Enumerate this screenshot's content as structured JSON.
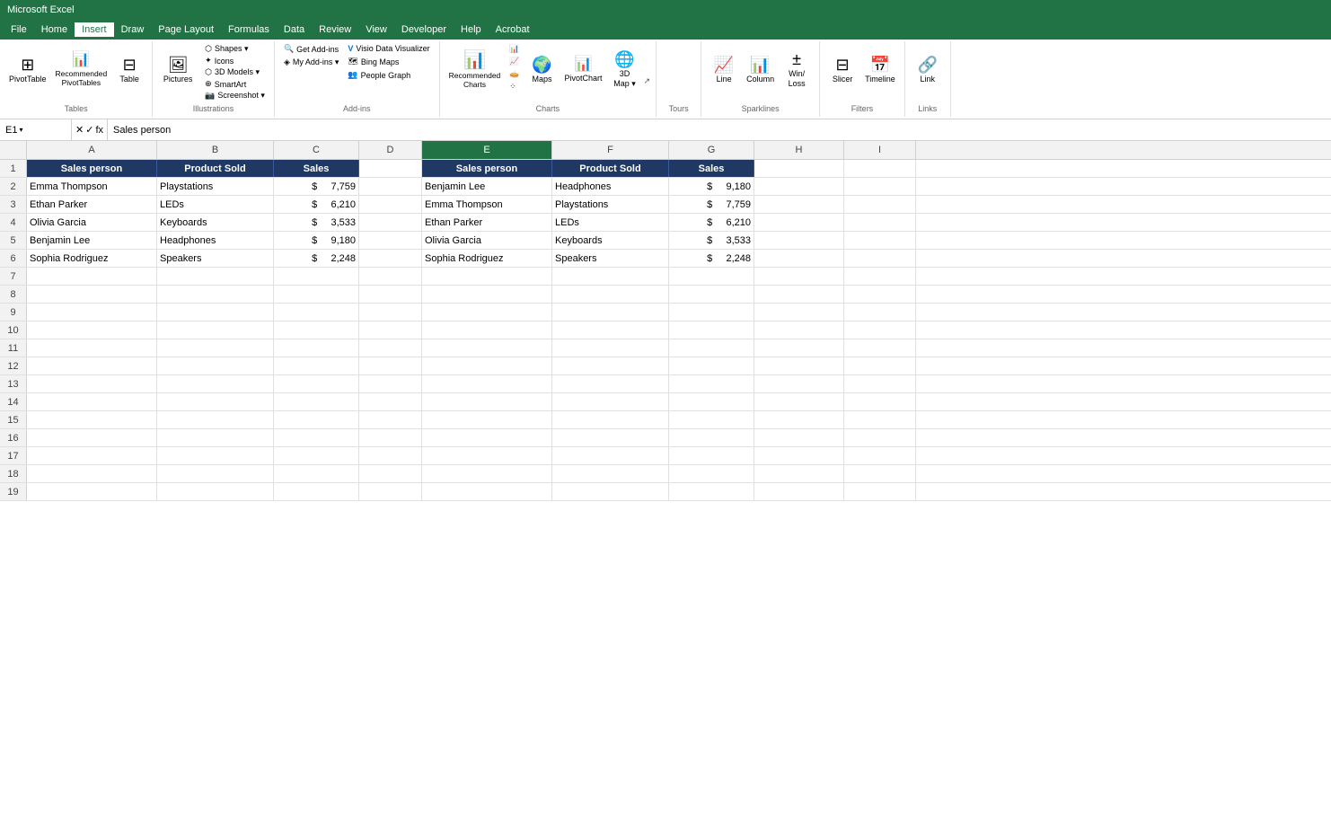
{
  "titleBar": {
    "text": "Microsoft Excel"
  },
  "menuBar": {
    "items": [
      "File",
      "Home",
      "Insert",
      "Draw",
      "Page Layout",
      "Formulas",
      "Data",
      "Review",
      "View",
      "Developer",
      "Help",
      "Acrobat"
    ]
  },
  "ribbon": {
    "activeTab": "Insert",
    "groups": {
      "tables": {
        "label": "Tables",
        "buttons": [
          {
            "id": "pivot-table",
            "label": "PivotTable",
            "icon": "⊞",
            "size": "large"
          },
          {
            "id": "recommended-pivot",
            "label": "Recommended\nPivotTables",
            "icon": "📊",
            "size": "large"
          },
          {
            "id": "table",
            "label": "Table",
            "icon": "⊟",
            "size": "large"
          }
        ]
      },
      "illustrations": {
        "label": "Illustrations",
        "buttons": [
          {
            "id": "pictures",
            "label": "Pictures",
            "icon": "🖼",
            "size": "large"
          },
          {
            "id": "shapes",
            "label": "Shapes ▾",
            "icon": "⬡",
            "size": "small"
          },
          {
            "id": "icons",
            "label": "Icons",
            "icon": "✦",
            "size": "small"
          },
          {
            "id": "3d-models",
            "label": "3D Models ▾",
            "icon": "⬡",
            "size": "small"
          },
          {
            "id": "smartart",
            "label": "SmartArt",
            "icon": "⊕",
            "size": "small"
          },
          {
            "id": "screenshot",
            "label": "Screenshot ▾",
            "icon": "📷",
            "size": "small"
          }
        ]
      },
      "addins": {
        "label": "Add-ins",
        "buttons": [
          {
            "id": "get-addins",
            "label": "Get Add-ins",
            "icon": "🔍"
          },
          {
            "id": "my-addins",
            "label": "My Add-ins ▾",
            "icon": "⚙"
          },
          {
            "id": "visio",
            "label": "Visio Data\nVisualizer",
            "icon": "V"
          },
          {
            "id": "bing-maps",
            "label": "Bing Maps",
            "icon": "🗺"
          },
          {
            "id": "people-graph",
            "label": "People Graph",
            "icon": "👥"
          }
        ]
      },
      "charts": {
        "label": "Charts",
        "buttons": [
          {
            "id": "recommended-charts",
            "label": "Recommended\nCharts",
            "icon": "📊"
          },
          {
            "id": "column-chart",
            "label": "",
            "icon": "📊"
          },
          {
            "id": "maps",
            "label": "Maps",
            "icon": "🗺"
          },
          {
            "id": "pivot-chart",
            "label": "PivotChart",
            "icon": "📊"
          },
          {
            "id": "3d-map",
            "label": "3D\nMap ▾",
            "icon": "🌐"
          }
        ]
      },
      "sparklines": {
        "label": "Sparklines",
        "buttons": [
          {
            "id": "line",
            "label": "Line",
            "icon": "📈"
          },
          {
            "id": "column-spark",
            "label": "Column",
            "icon": "📊"
          },
          {
            "id": "win-loss",
            "label": "Win/\nLoss",
            "icon": "±"
          }
        ]
      },
      "filters": {
        "label": "Filters",
        "buttons": [
          {
            "id": "slicer",
            "label": "Slicer",
            "icon": "⊟"
          },
          {
            "id": "timeline",
            "label": "Timeline",
            "icon": "📅"
          }
        ]
      },
      "links": {
        "label": "Links",
        "buttons": [
          {
            "id": "link",
            "label": "Link",
            "icon": "🔗"
          }
        ]
      }
    }
  },
  "formulaBar": {
    "cellRef": "E1",
    "formula": "Sales person"
  },
  "columns": {
    "headers": [
      "A",
      "B",
      "C",
      "D",
      "E",
      "F",
      "G",
      "H",
      "I"
    ],
    "widths": [
      145,
      130,
      95,
      70,
      145,
      130,
      95,
      100,
      80
    ]
  },
  "tableHeaders": {
    "leftTable": [
      "Sales person",
      "Product Sold",
      "Sales"
    ],
    "rightTable": [
      "Sales person",
      "Product Sold",
      "Sales"
    ]
  },
  "tableData": {
    "left": [
      {
        "person": "Emma Thompson",
        "product": "Playstations",
        "currency": "$",
        "amount": "7,759"
      },
      {
        "person": "Ethan Parker",
        "product": "LEDs",
        "currency": "$",
        "amount": "6,210"
      },
      {
        "person": "Olivia Garcia",
        "product": "Keyboards",
        "currency": "$",
        "amount": "3,533"
      },
      {
        "person": "Benjamin Lee",
        "product": "Headphones",
        "currency": "$",
        "amount": "9,180"
      },
      {
        "person": "Sophia Rodriguez",
        "product": "Speakers",
        "currency": "$",
        "amount": "2,248"
      }
    ],
    "right": [
      {
        "person": "Benjamin Lee",
        "product": "Headphones",
        "currency": "$",
        "amount": "9,180"
      },
      {
        "person": "Emma Thompson",
        "product": "Playstations",
        "currency": "$",
        "amount": "7,759"
      },
      {
        "person": "Ethan Parker",
        "product": "LEDs",
        "currency": "$",
        "amount": "6,210"
      },
      {
        "person": "Olivia Garcia",
        "product": "Keyboards",
        "currency": "$",
        "amount": "3,533"
      },
      {
        "person": "Sophia Rodriguez",
        "product": "Speakers",
        "currency": "$",
        "amount": "2,248"
      }
    ]
  },
  "rows": {
    "numbers": [
      1,
      2,
      3,
      4,
      5,
      6,
      7,
      8,
      9,
      10,
      11,
      12,
      13,
      14,
      15,
      16,
      17,
      18,
      19
    ]
  }
}
